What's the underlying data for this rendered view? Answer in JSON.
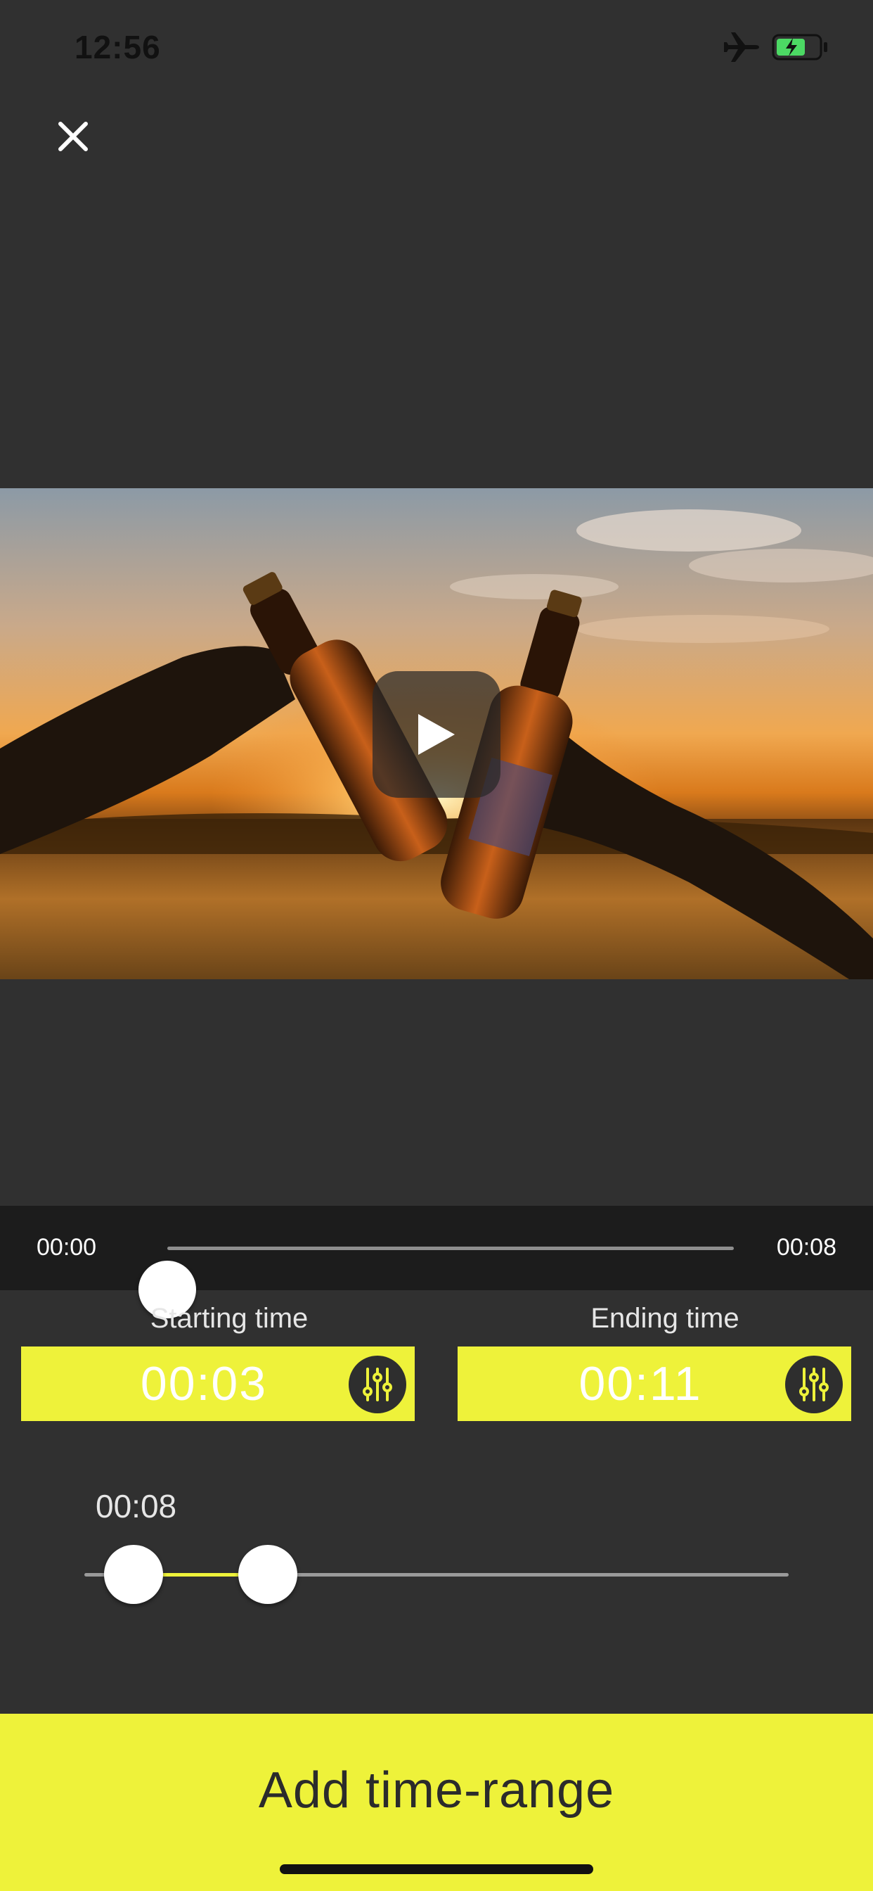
{
  "status_bar": {
    "time": "12:56",
    "airplane_icon": "airplane-icon",
    "battery_icon": "battery-charging-icon",
    "battery_color": "#4cd964"
  },
  "close_icon": "close-icon",
  "video": {
    "play_icon": "play-icon"
  },
  "seek": {
    "start_label": "00:00",
    "end_label": "00:08",
    "position_fraction": 0
  },
  "starting": {
    "caption": "Starting time",
    "value": "00:03",
    "icon": "sliders-icon"
  },
  "ending": {
    "caption": "Ending time",
    "value": "00:11",
    "icon": "sliders-icon"
  },
  "range": {
    "duration_label": "00:08",
    "start_fraction": 0.07,
    "end_fraction": 0.26
  },
  "add_button": {
    "label": "Add time-range"
  },
  "colors": {
    "accent": "#eef23a",
    "background": "#303030",
    "seek_bar_background": "#1c1c1c"
  }
}
